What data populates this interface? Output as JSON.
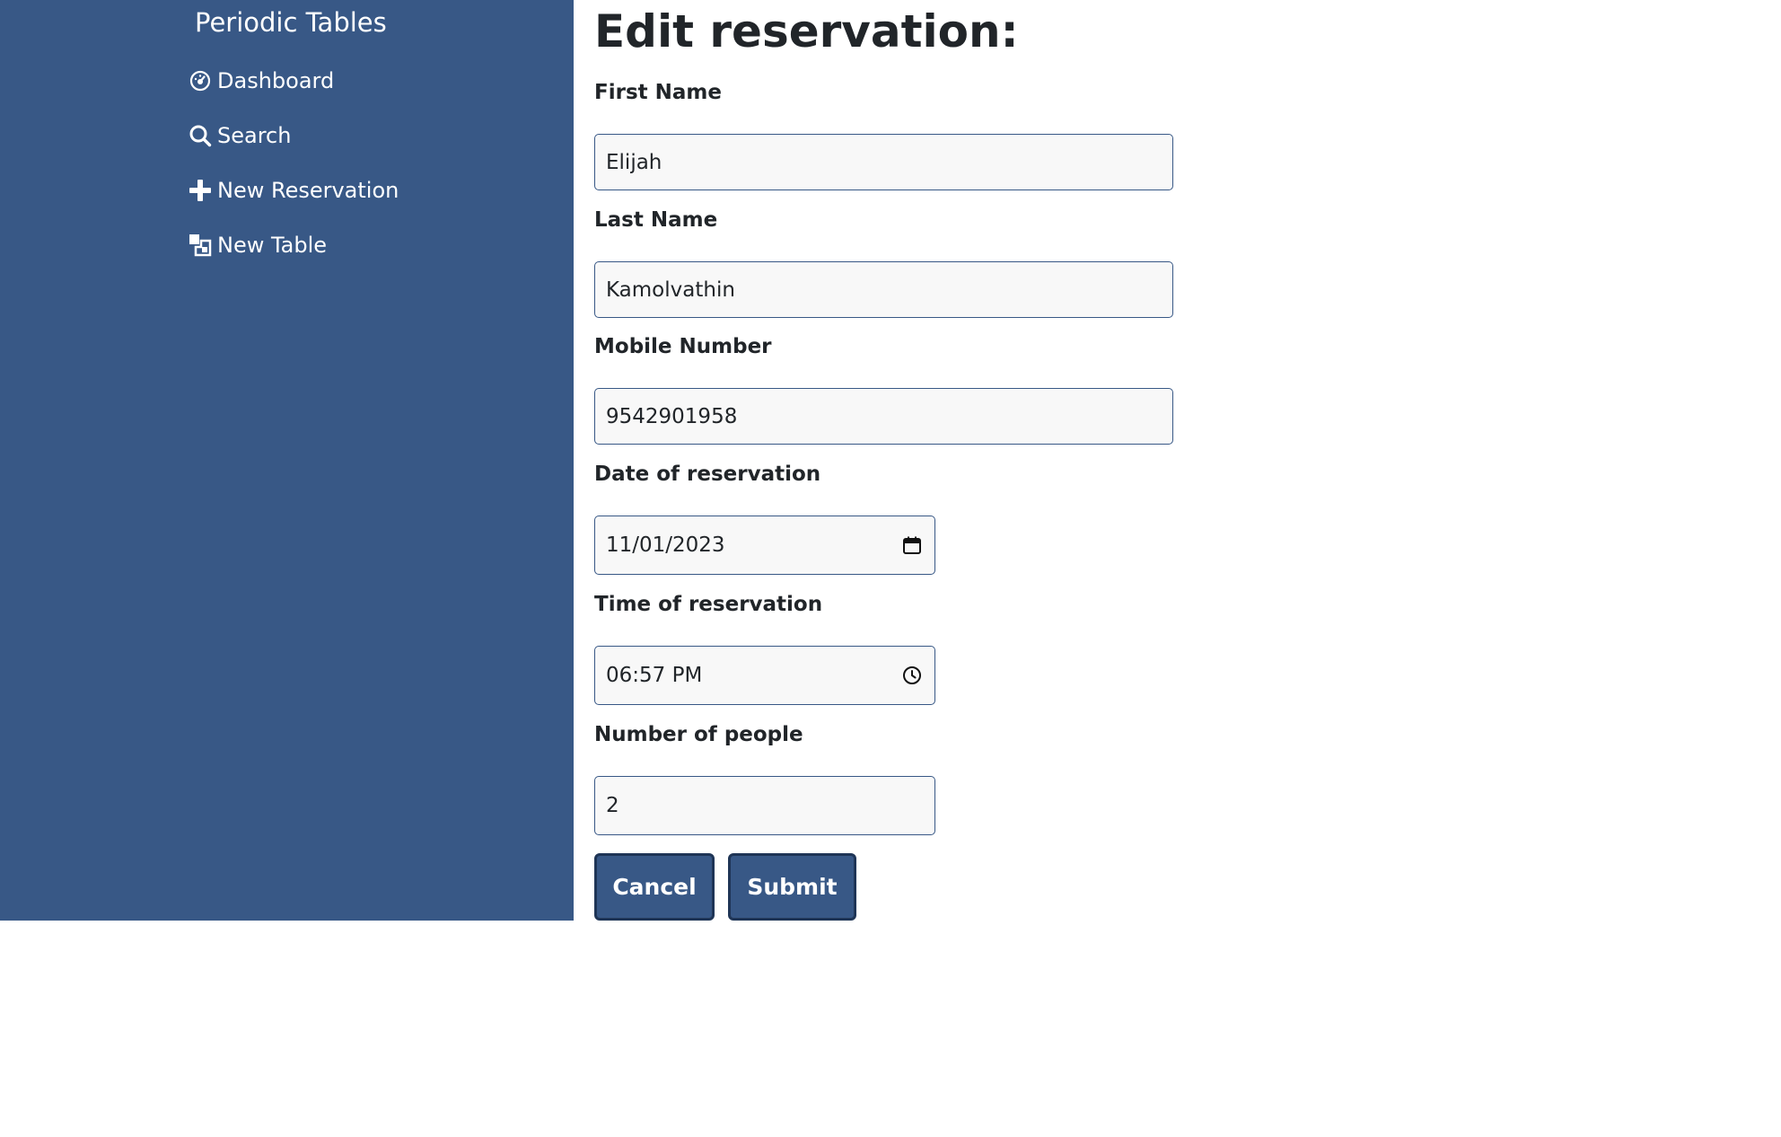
{
  "sidebar": {
    "brand": "Periodic Tables",
    "items": [
      {
        "label": "Dashboard",
        "icon": "dashboard-icon"
      },
      {
        "label": "Search",
        "icon": "search-icon"
      },
      {
        "label": "New Reservation",
        "icon": "plus-icon"
      },
      {
        "label": "New Table",
        "icon": "new-table-icon"
      }
    ]
  },
  "main": {
    "title": "Edit reservation:",
    "fields": {
      "first_name": {
        "label": "First Name",
        "value": "Elijah"
      },
      "last_name": {
        "label": "Last Name",
        "value": "Kamolvathin"
      },
      "mobile_number": {
        "label": "Mobile Number",
        "value": "9542901958"
      },
      "reservation_date": {
        "label": "Date of reservation",
        "value": "11/01/2023",
        "icon": "calendar-icon"
      },
      "reservation_time": {
        "label": "Time of reservation",
        "value": "06:57 PM",
        "icon": "clock-icon"
      },
      "people": {
        "label": "Number of people",
        "value": "2"
      }
    },
    "buttons": {
      "cancel": "Cancel",
      "submit": "Submit"
    }
  },
  "colors": {
    "sidebar_bg": "#385886",
    "button_bg": "#385886",
    "input_bg": "#f8f8f8",
    "text": "#212529"
  }
}
